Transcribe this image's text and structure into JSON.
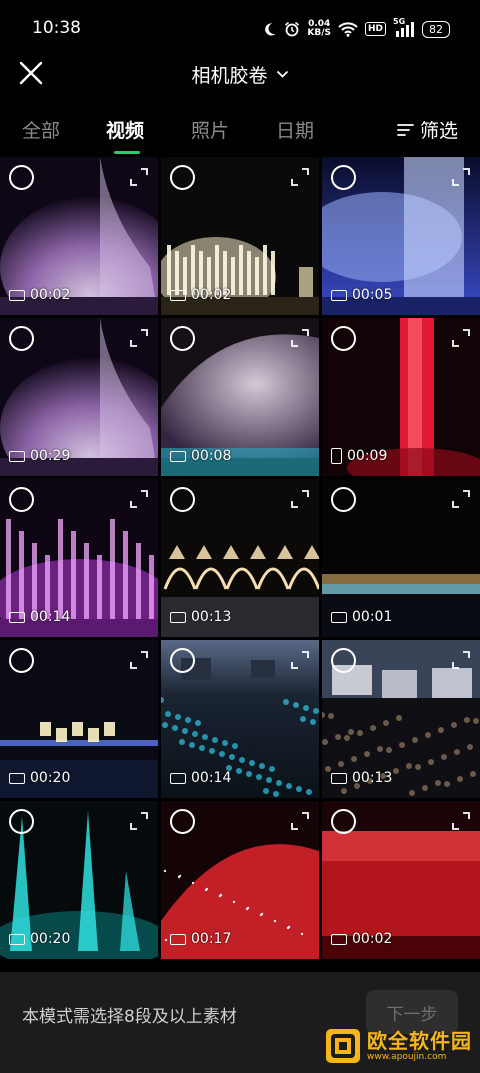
{
  "status_bar": {
    "time": "10:38",
    "net_speed_value": "0.04",
    "net_speed_unit": "KB/S",
    "hd_label": "HD",
    "signal_label": "5G",
    "battery": "82",
    "icons": [
      "moon-icon",
      "alarm-icon",
      "wifi-icon",
      "signal-icon"
    ]
  },
  "header": {
    "title": "相机胶卷",
    "close_icon": "close-icon",
    "dropdown_icon": "chevron-down-icon"
  },
  "tabs": [
    {
      "label": "全部",
      "active": false
    },
    {
      "label": "视频",
      "active": true
    },
    {
      "label": "照片",
      "active": false
    },
    {
      "label": "日期",
      "active": false
    }
  ],
  "filter": {
    "label": "筛选",
    "icon": "filter-icon"
  },
  "accent_color": "#2ecb6d",
  "videos": [
    {
      "duration": "00:02",
      "orientation": "landscape",
      "scene": "purple-mist"
    },
    {
      "duration": "00:02",
      "orientation": "landscape",
      "scene": "white-fountain"
    },
    {
      "duration": "00:05",
      "orientation": "landscape",
      "scene": "blue-spray"
    },
    {
      "duration": "00:29",
      "orientation": "landscape",
      "scene": "purple-mist"
    },
    {
      "duration": "00:08",
      "orientation": "landscape",
      "scene": "white-arc"
    },
    {
      "duration": "00:09",
      "orientation": "portrait",
      "scene": "red-column"
    },
    {
      "duration": "00:14",
      "orientation": "landscape",
      "scene": "magenta-jets"
    },
    {
      "duration": "00:13",
      "orientation": "landscape",
      "scene": "golden-arches"
    },
    {
      "duration": "00:01",
      "orientation": "landscape",
      "scene": "rainbow-line"
    },
    {
      "duration": "00:20",
      "orientation": "landscape",
      "scene": "text-lights"
    },
    {
      "duration": "00:14",
      "orientation": "landscape",
      "scene": "crowd-blue"
    },
    {
      "duration": "00:13",
      "orientation": "landscape",
      "scene": "crowd-city"
    },
    {
      "duration": "00:20",
      "orientation": "landscape",
      "scene": "cyan-jets"
    },
    {
      "duration": "00:17",
      "orientation": "landscape",
      "scene": "red-fan"
    },
    {
      "duration": "00:02",
      "orientation": "landscape",
      "scene": "red-wall"
    }
  ],
  "bottom_bar": {
    "hint": "本模式需选择8段及以上素材",
    "next_label": "下一步"
  },
  "watermark": {
    "text": "欧全软件园",
    "url": "www.apoujin.com"
  }
}
